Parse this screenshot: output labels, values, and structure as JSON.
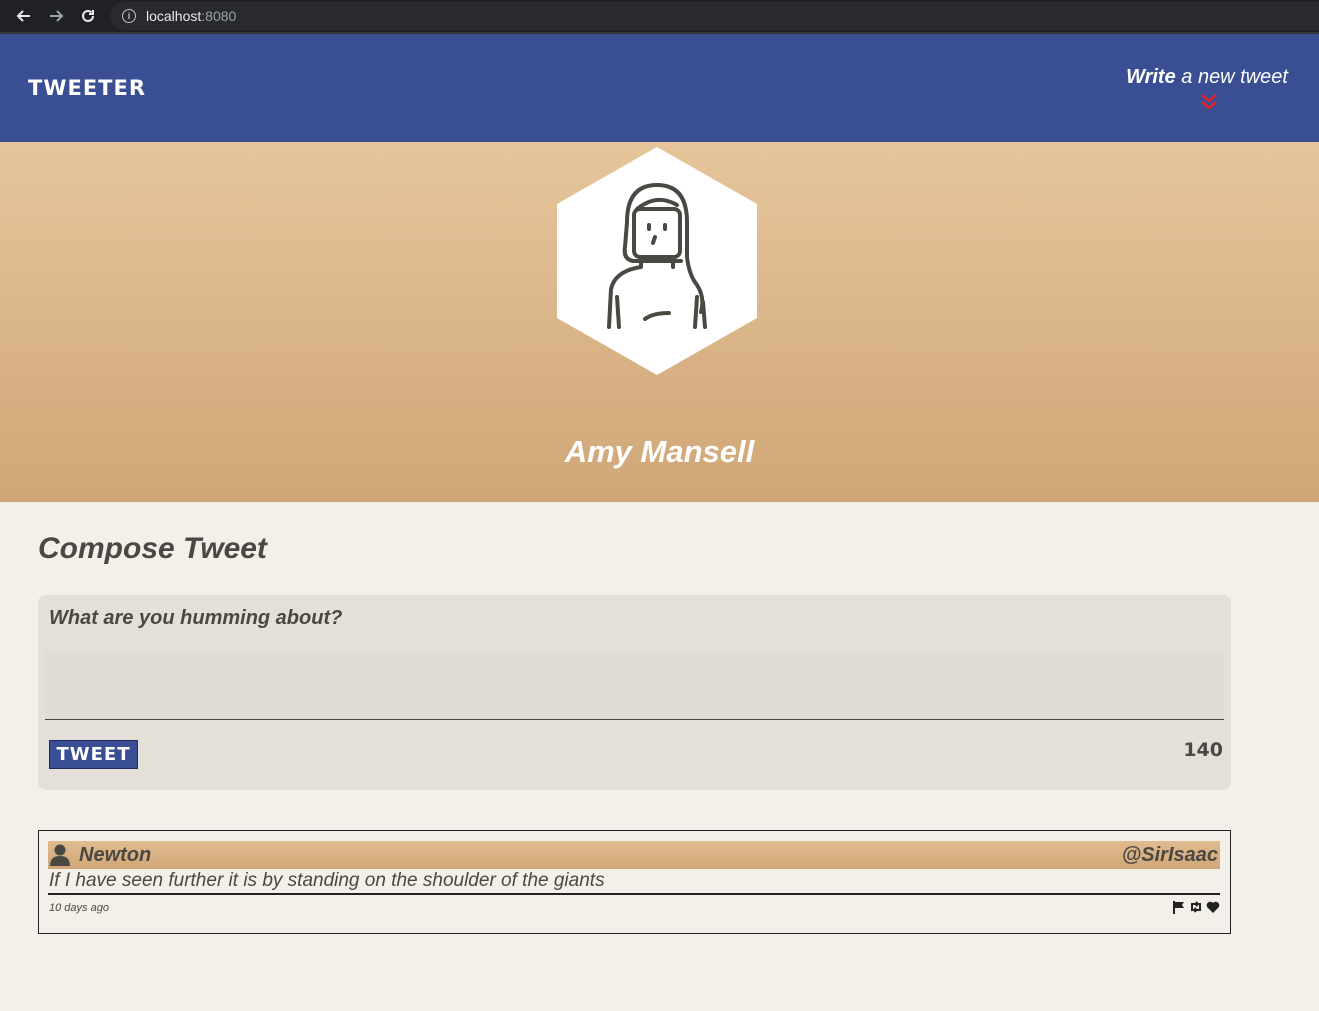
{
  "browser": {
    "host": "localhost",
    "port": ":8080"
  },
  "nav": {
    "brand": "TWEETER",
    "write_bold": "Write",
    "write_rest": " a new tweet"
  },
  "profile": {
    "name": "Amy Mansell"
  },
  "compose": {
    "title": "Compose Tweet",
    "label": "What are you humming about?",
    "textarea_value": "",
    "button_label": "TWEET",
    "counter": "140"
  },
  "tweets": [
    {
      "name": "Newton",
      "handle": "@SirIsaac",
      "content": "If I have seen further it is by standing on the shoulder of the giants",
      "time": "10 days ago"
    }
  ],
  "colors": {
    "nav_bg": "#3a4e93",
    "profile_gradient_top": "#e6c59b",
    "profile_gradient_bottom": "#cfa677",
    "page_bg": "#f3efe9",
    "accent_red": "#e0232f"
  },
  "icons": {
    "back": "arrow-left-icon",
    "forward": "arrow-right-icon",
    "reload": "reload-icon",
    "site_info": "info-icon",
    "chevron": "double-chevron-down-icon",
    "avatar": "woman-avatar-icon",
    "user": "user-icon",
    "flag": "flag-icon",
    "retweet": "retweet-icon",
    "like": "heart-icon"
  }
}
